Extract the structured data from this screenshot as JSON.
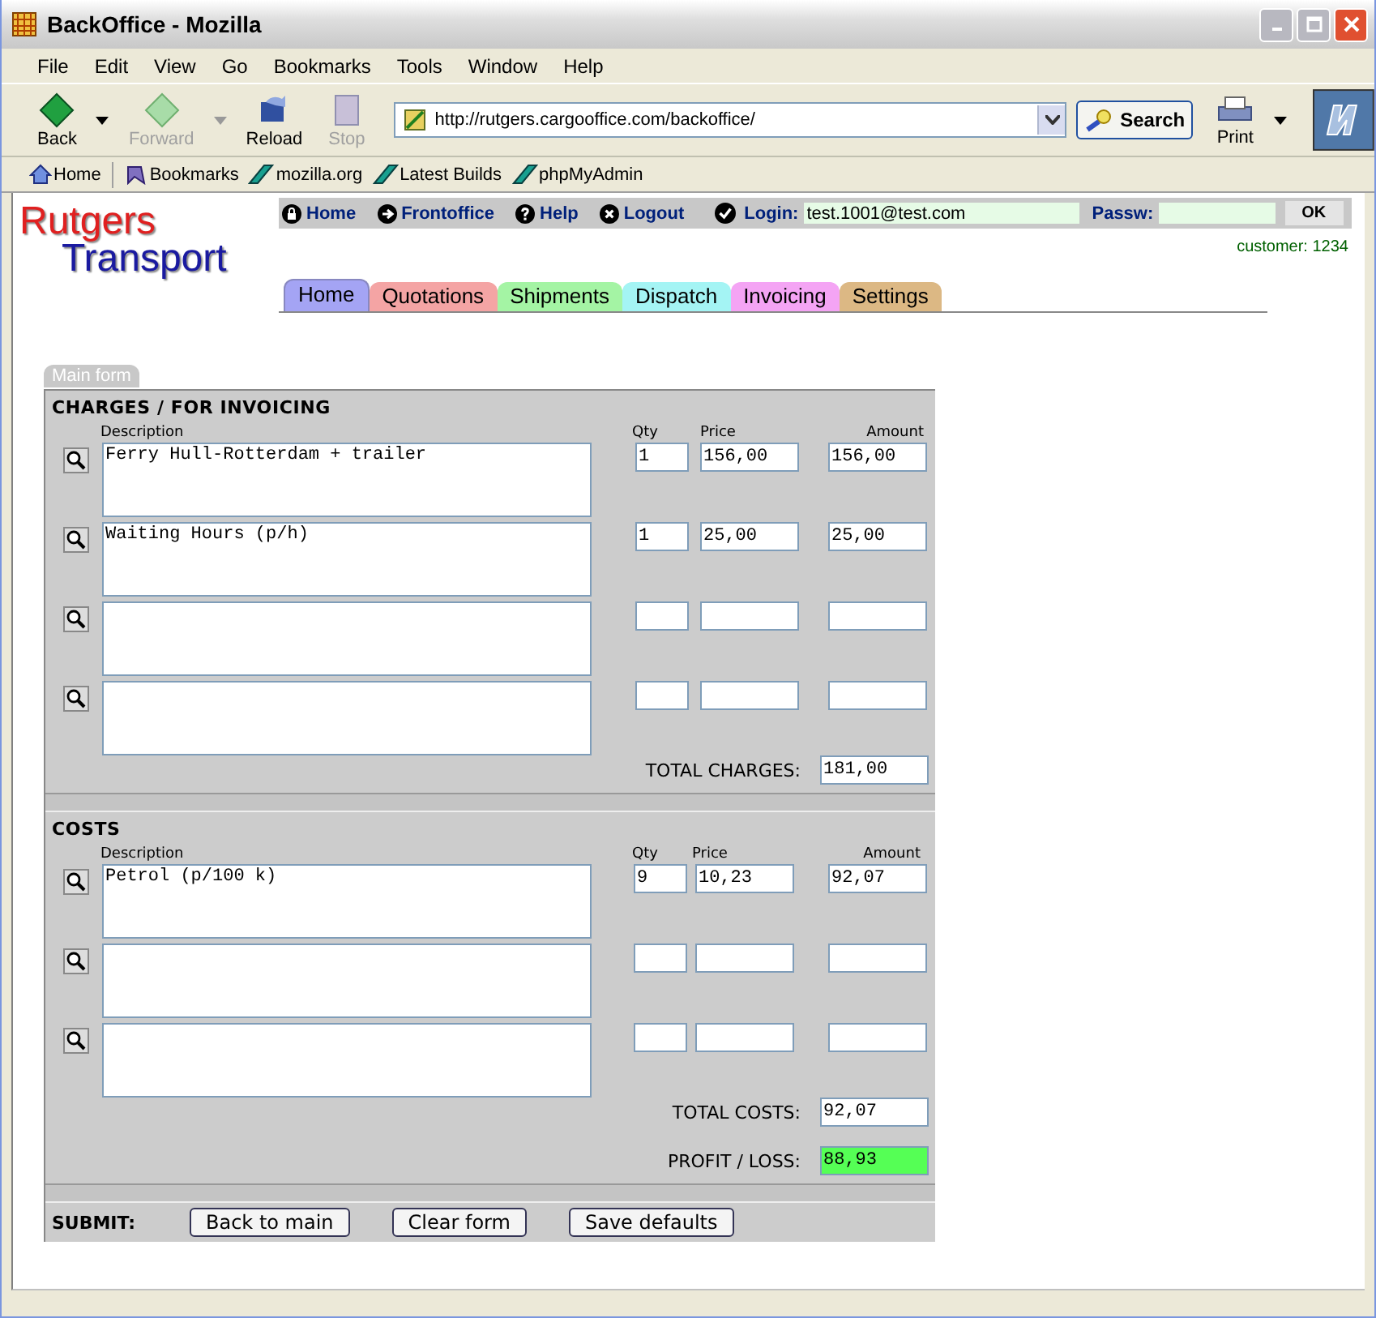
{
  "window": {
    "title": "BackOffice - Mozilla"
  },
  "menu": [
    "File",
    "Edit",
    "View",
    "Go",
    "Bookmarks",
    "Tools",
    "Window",
    "Help"
  ],
  "toolbar": [
    {
      "label": "Back",
      "kind": "back",
      "disabled": false
    },
    {
      "label": "Forward",
      "kind": "forward",
      "disabled": true
    },
    {
      "label": "Reload",
      "kind": "reload",
      "disabled": false
    },
    {
      "label": "Stop",
      "kind": "stop",
      "disabled": true
    }
  ],
  "address": {
    "value": "http://rutgers.cargooffice.com/backoffice/"
  },
  "search_button": "Search",
  "print_button": "Print",
  "bookmarks_bar": [
    {
      "label": "Home",
      "kind": "home"
    },
    {
      "label": "Bookmarks",
      "kind": "bookmarks"
    },
    {
      "label": "mozilla.org",
      "kind": "link"
    },
    {
      "label": "Latest Builds",
      "kind": "link"
    },
    {
      "label": "phpMyAdmin",
      "kind": "link"
    }
  ],
  "logo": {
    "line_1": "Rutgers",
    "line_2": "Transport"
  },
  "site_nav": [
    {
      "label": "Home",
      "kind": "lock"
    },
    {
      "label": "Frontoffice",
      "kind": "arrow"
    },
    {
      "label": "Help",
      "kind": "help"
    },
    {
      "label": "Logout",
      "kind": "close"
    }
  ],
  "login": {
    "label": "Login:",
    "value": "test.1001@test.com",
    "password_label": "Passw:",
    "ok": "OK"
  },
  "customer": "customer: 1234",
  "tabs": [
    {
      "label": "Home",
      "color": "#a4a4f4",
      "selected": true
    },
    {
      "label": "Quotations",
      "color": "#f4a4a4",
      "selected": false
    },
    {
      "label": "Shipments",
      "color": "#a4f4a4",
      "selected": false
    },
    {
      "label": "Dispatch",
      "color": "#a4f4f4",
      "selected": false
    },
    {
      "label": "Invoicing",
      "color": "#f4a4f4",
      "selected": false
    },
    {
      "label": "Settings",
      "color": "#dcb884",
      "selected": false
    }
  ],
  "form_tab": "Main form",
  "charges": {
    "title": "CHARGES / FOR INVOICING",
    "columns": [
      "Description",
      "Qty",
      "Price",
      "Amount"
    ],
    "rows": [
      {
        "description": "Ferry Hull-Rotterdam + trailer",
        "qty": "1",
        "price": "156,00",
        "amount": "156,00"
      },
      {
        "description": "Waiting Hours (p/h)",
        "qty": "1",
        "price": "25,00",
        "amount": "25,00"
      },
      {},
      {}
    ],
    "total_label": "TOTAL CHARGES:",
    "total": "181,00"
  },
  "costs": {
    "title": "COSTS",
    "columns": [
      "Description",
      "Qty",
      "Price",
      "Amount"
    ],
    "rows": [
      {
        "description": "Petrol (p/100 k)",
        "qty": "9",
        "price": "10,23",
        "amount": "92,07"
      },
      {},
      {}
    ],
    "total_label": "TOTAL COSTS:",
    "total": "92,07",
    "profit_label": "PROFIT / LOSS:",
    "profit": "88,93"
  },
  "submit": {
    "label": "SUBMIT:",
    "buttons": [
      "Back to main",
      "Clear form",
      "Save defaults"
    ]
  }
}
